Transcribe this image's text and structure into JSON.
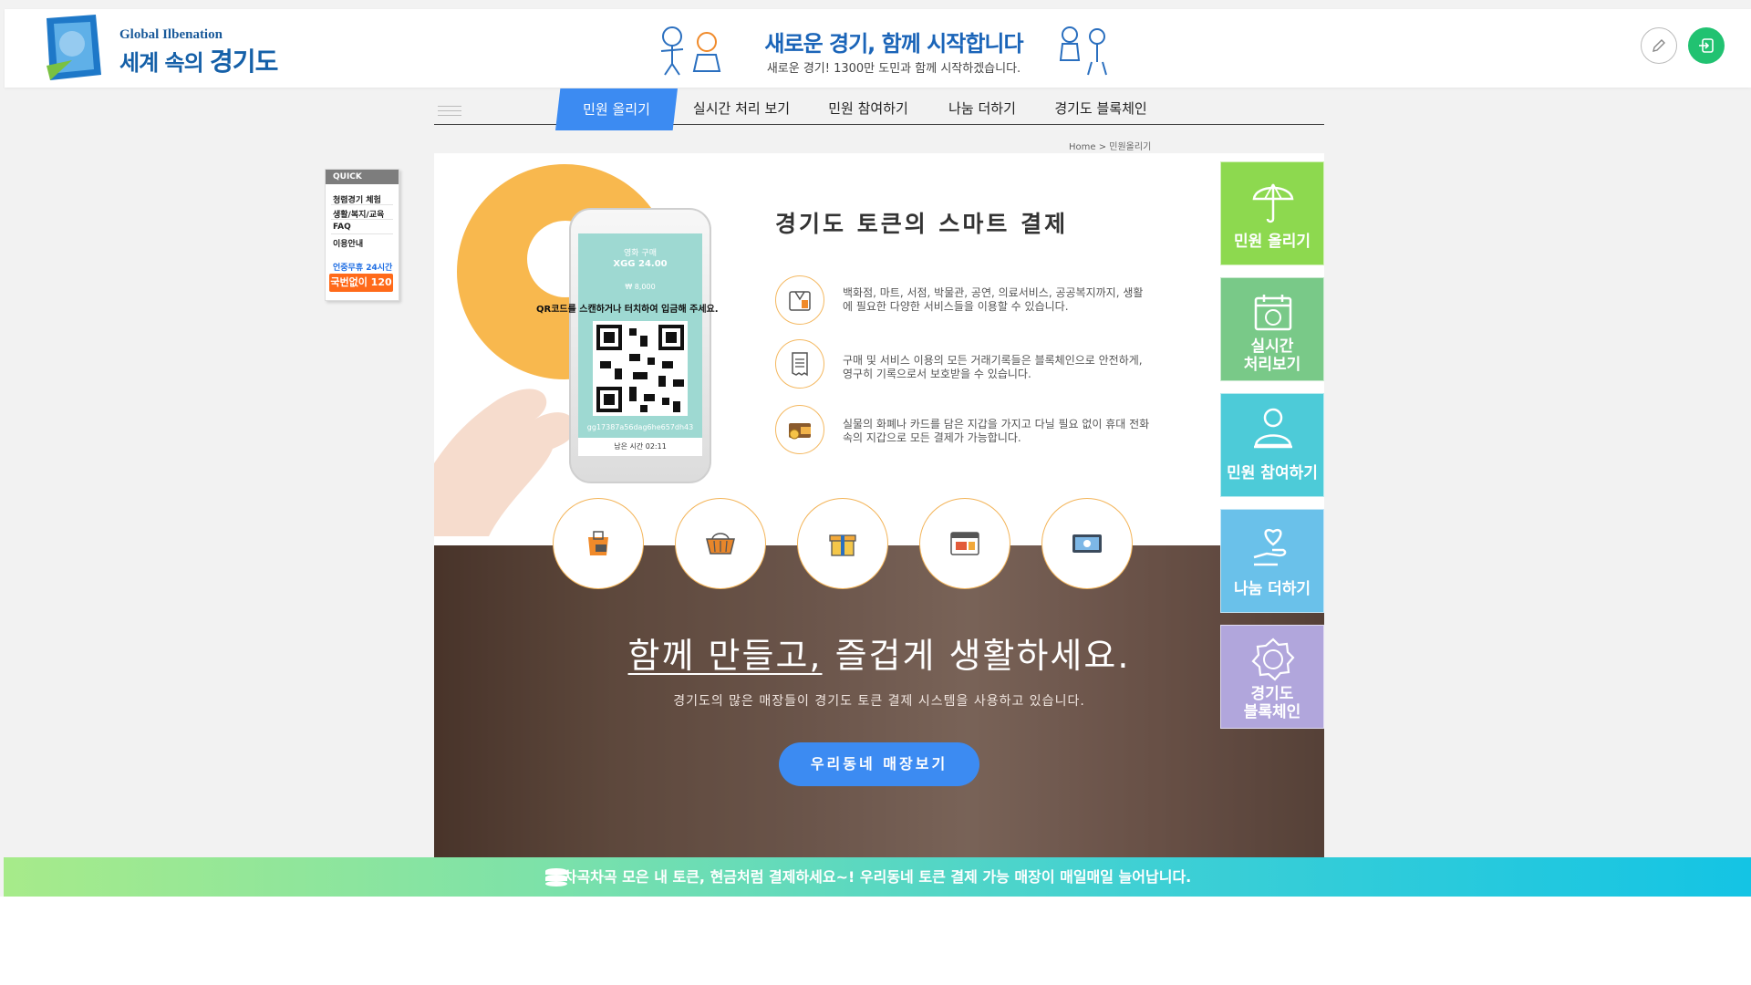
{
  "header": {
    "logo_en": "Global Ilbenation",
    "logo_ko_prefix": "세계 속의",
    "logo_ko_main": "경기도",
    "banner_title": "새로운 경기, 함께 시작합니다",
    "banner_sub": "새로운 경기! 1300만 도민과 함께 시작하겠습니다."
  },
  "nav": {
    "items": [
      "민원 올리기",
      "실시간 처리 보기",
      "민원 참여하기",
      "나눔 더하기",
      "경기도 블록체인"
    ],
    "active_index": 0
  },
  "breadcrumb": "Home > 민원올리기",
  "quick": {
    "title": "QUICK",
    "items": [
      "청렴경기 체험",
      "생활/복지/교육",
      "FAQ",
      "이용안내"
    ],
    "hours": "언중무휴 24시간",
    "hotline": "국번없이 120"
  },
  "phone": {
    "title": "영화 구매",
    "amount": "XGG 24.00",
    "won": "₩ 8,000",
    "instruction": "QR코드를 스캔하거나 터치하여 입금해 주세요.",
    "hash": "gg17387a56dag6he657dh43",
    "timer": "남은 시간 02:11"
  },
  "features": {
    "title": "경기도 토큰의 스마트 결제",
    "items": [
      {
        "icon": "shopping-bag-icon",
        "text": "백화점, 마트, 서점, 박물관, 공연, 의료서비스, 공공복지까지, 생활에 필요한 다양한 서비스들을 이용할 수 있습니다."
      },
      {
        "icon": "receipt-icon",
        "text": "구매 및 서비스 이용의 모든 거래기록들은 블록체인으로 안전하게, 영구히 기록으로서 보호받을 수 있습니다."
      },
      {
        "icon": "wallet-icon",
        "text": "실물의 화폐나 카드를 담은 지갑을 가지고 다닐 필요 없이 휴대 전화 속의 지갑으로 모든 결제가 가능합니다."
      }
    ]
  },
  "service_icons": [
    "sale-bag-icon",
    "basket-icon",
    "gift-icon",
    "ticket-icon",
    "cash-icon"
  ],
  "promo": {
    "slogan_underlined": "함께 만들고,",
    "slogan_rest": " 즐겁게 생활하세요.",
    "sub": "경기도의 많은 매장들이 경기도 토큰 결제 시스템을 사용하고 있습니다.",
    "button": "우리동네 매장보기"
  },
  "tiles": [
    {
      "label": "민원 올리기",
      "color": "#8dd94f",
      "icon": "umbrella-icon"
    },
    {
      "label": "실시간 처리보기",
      "line1": "실시간",
      "line2": "처리보기",
      "color": "#79c988",
      "icon": "calendar-icon"
    },
    {
      "label": "민원 참여하기",
      "color": "#4dcbd8",
      "icon": "coin-hand-icon"
    },
    {
      "label": "나눔 더하기",
      "color": "#6ac1ea",
      "icon": "heart-hand-icon"
    },
    {
      "label": "경기도 블록체인",
      "line1": "경기도",
      "line2": "블록체인",
      "color": "#b1a6dc",
      "icon": "badge-icon"
    }
  ],
  "ticker": "차곡차곡 모은 내 토큰, 현금처럼 결제하세요~! 우리동네 토큰 결제 가능 매장이 매일매일 늘어납니다."
}
